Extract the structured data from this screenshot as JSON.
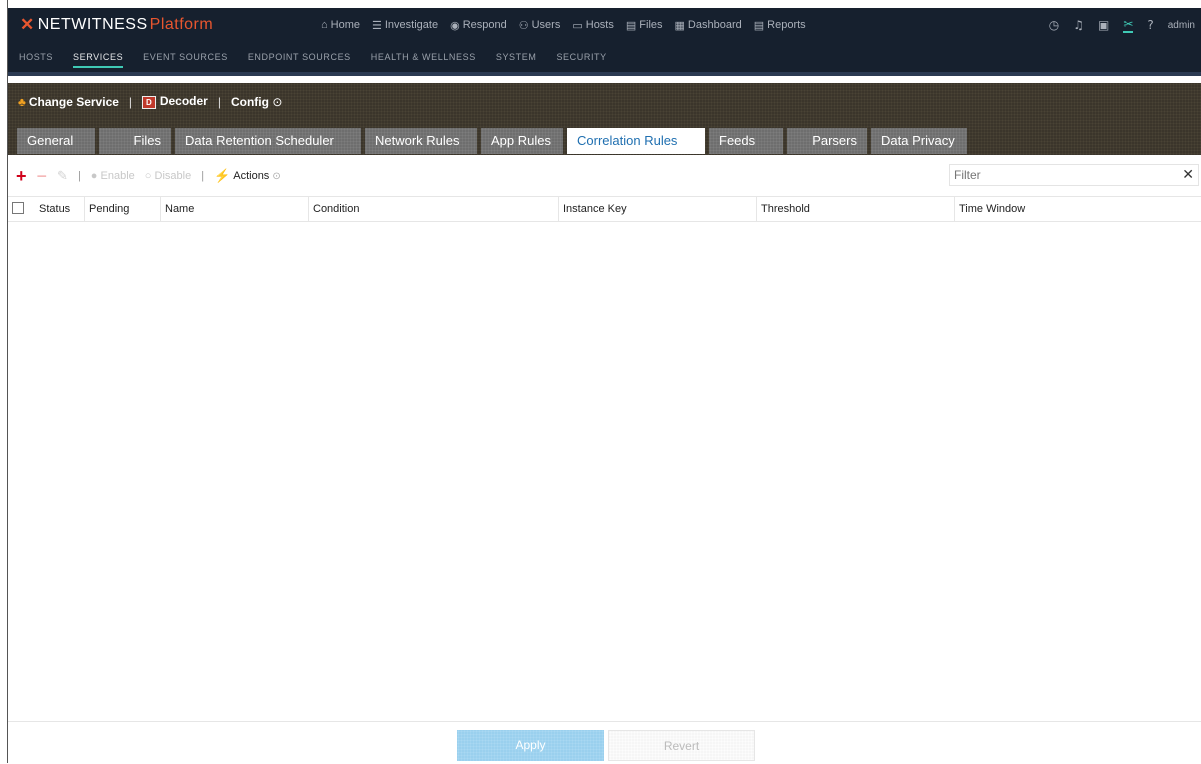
{
  "app": {
    "logo_main": "NETWITNESS",
    "logo_sub": "Platform",
    "user": "admin"
  },
  "main_nav": [
    {
      "icon": "home-icon",
      "glyph": "⌂",
      "label": "Home"
    },
    {
      "icon": "investigate-icon",
      "glyph": "☰",
      "label": "Investigate"
    },
    {
      "icon": "respond-icon",
      "glyph": "◉",
      "label": "Respond"
    },
    {
      "icon": "users-icon",
      "glyph": "⚇",
      "label": "Users"
    },
    {
      "icon": "hosts-icon",
      "glyph": "▭",
      "label": "Hosts"
    },
    {
      "icon": "files-icon",
      "glyph": "▤",
      "label": "Files"
    },
    {
      "icon": "dashboard-icon",
      "glyph": "▦",
      "label": "Dashboard"
    },
    {
      "icon": "reports-icon",
      "glyph": "▤",
      "label": "Reports"
    }
  ],
  "sub_nav": [
    "HOSTS",
    "SERVICES",
    "EVENT SOURCES",
    "ENDPOINT SOURCES",
    "HEALTH & WELLNESS",
    "SYSTEM",
    "SECURITY"
  ],
  "service_bar": {
    "change_service": "Change Service",
    "decoder": "Decoder",
    "config": "Config"
  },
  "tabs": [
    "General",
    "Files",
    "Data Retention Scheduler",
    "Network Rules",
    "App Rules",
    "Correlation Rules",
    "Feeds",
    "Parsers",
    "Data Privacy"
  ],
  "active_tab": "Correlation Rules",
  "toolbar": {
    "enable": "Enable",
    "disable": "Disable",
    "actions": "Actions",
    "filter_placeholder": "Filter"
  },
  "table": {
    "columns": [
      "Status",
      "Pending",
      "Name",
      "Condition",
      "Instance Key",
      "Threshold",
      "Time Window"
    ],
    "rows": []
  },
  "footer": {
    "apply": "Apply",
    "revert": "Revert"
  },
  "colors": {
    "topbar": "#16202e",
    "accent": "#3fc9b5",
    "brand_orange": "#e8562f",
    "active_tab_text": "#1f6fb0"
  }
}
